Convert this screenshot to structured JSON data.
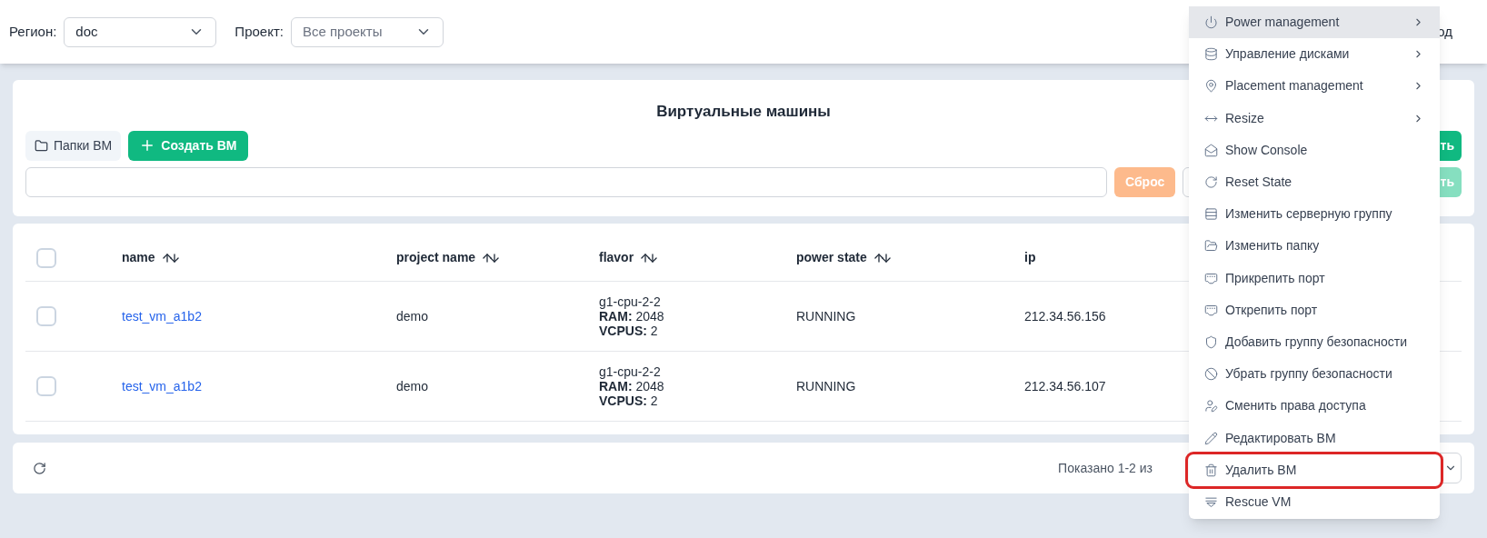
{
  "header": {
    "region_label": "Регион:",
    "region_value": "doc",
    "project_label": "Проект:",
    "project_placeholder": "Все проекты",
    "right_text_partial": "од"
  },
  "toolbar": {
    "title": "Виртуальные машины",
    "folders_button": "Папки ВМ",
    "create_button": "Создать ВМ",
    "right_button_partial": "ть",
    "right_button2_partial": "ть",
    "reset_button": "Сброс"
  },
  "table": {
    "columns": [
      {
        "label": "name",
        "sortable": true
      },
      {
        "label": "project name",
        "sortable": true
      },
      {
        "label": "flavor",
        "sortable": true
      },
      {
        "label": "power state",
        "sortable": true
      },
      {
        "label": "ip",
        "sortable": false
      }
    ],
    "select_all_checked": false,
    "rows": [
      {
        "checked": false,
        "name": "test_vm_a1b2",
        "project": "demo",
        "flavor": "g1-cpu-2-2",
        "ram_label": "RAM:",
        "ram": "2048",
        "vcpus_label": "VCPUS:",
        "vcpus": "2",
        "power_state": "RUNNING",
        "ip": "212.34.56.156"
      },
      {
        "checked": false,
        "name": "test_vm_a1b2",
        "project": "demo",
        "flavor": "g1-cpu-2-2",
        "ram_label": "RAM:",
        "ram": "2048",
        "vcpus_label": "VCPUS:",
        "vcpus": "2",
        "power_state": "RUNNING",
        "ip": "212.34.56.107"
      }
    ]
  },
  "footer": {
    "shown_text": "Показано 1-2 из"
  },
  "context_menu": {
    "items": [
      {
        "label": "Power management",
        "submenu": true,
        "selected": true,
        "annotated": false
      },
      {
        "label": "Управление дисками",
        "submenu": true,
        "selected": false,
        "annotated": false
      },
      {
        "label": "Placement management",
        "submenu": true,
        "selected": false,
        "annotated": false
      },
      {
        "label": "Resize",
        "submenu": true,
        "selected": false,
        "annotated": false
      },
      {
        "label": "Show Console",
        "submenu": false,
        "selected": false,
        "annotated": false
      },
      {
        "label": "Reset State",
        "submenu": false,
        "selected": false,
        "annotated": false
      },
      {
        "label": "Изменить серверную группу",
        "submenu": false,
        "selected": false,
        "annotated": false
      },
      {
        "label": "Изменить папку",
        "submenu": false,
        "selected": false,
        "annotated": false
      },
      {
        "label": "Прикрепить порт",
        "submenu": false,
        "selected": false,
        "annotated": false
      },
      {
        "label": "Открепить порт",
        "submenu": false,
        "selected": false,
        "annotated": false
      },
      {
        "label": "Добавить группу безопасности",
        "submenu": false,
        "selected": false,
        "annotated": false
      },
      {
        "label": "Убрать группу безопасности",
        "submenu": false,
        "selected": false,
        "annotated": false
      },
      {
        "label": "Сменить права доступа",
        "submenu": false,
        "selected": false,
        "annotated": false
      },
      {
        "label": "Редактировать ВМ",
        "submenu": false,
        "selected": false,
        "annotated": false
      },
      {
        "label": "Удалить ВМ",
        "submenu": false,
        "selected": false,
        "annotated": true
      },
      {
        "label": "Rescue VM",
        "submenu": false,
        "selected": false,
        "annotated": false
      }
    ]
  }
}
